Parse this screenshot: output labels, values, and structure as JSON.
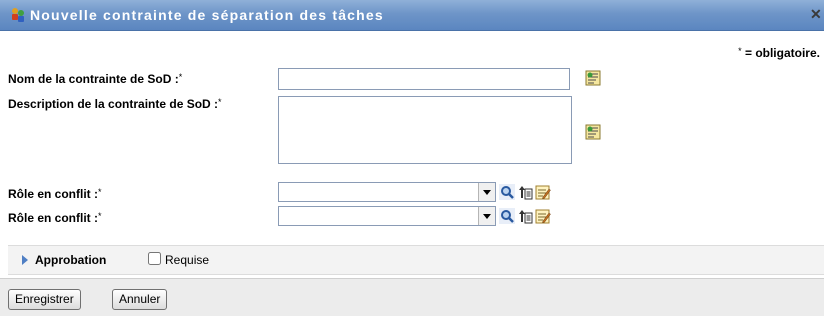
{
  "dialog": {
    "title": "Nouvelle contrainte de séparation des tâches",
    "close_symbol": "✕"
  },
  "required_note": {
    "asterisk": "*",
    "text": " = obligatoire."
  },
  "form": {
    "name_label": "Nom de la contrainte de SoD :",
    "name_value": "",
    "description_label": "Description de la contrainte de SoD :",
    "description_value": "",
    "conflict_role_1_label": "Rôle en conflit :",
    "conflict_role_1_value": "",
    "conflict_role_2_label": "Rôle en conflit :",
    "conflict_role_2_value": "",
    "required_asterisk": "*"
  },
  "approval": {
    "label": "Approbation",
    "checkbox_label": "Requise",
    "checked": false
  },
  "buttons": {
    "save": "Enregistrer",
    "cancel": "Annuler"
  },
  "icons": {
    "title": "role-conflict-icon",
    "localize": "localize-edit-icon",
    "search": "magnifier-search-icon",
    "history": "role-history-icon",
    "edit": "edit-form-icon"
  },
  "colors": {
    "title_bar": "#6e95c8",
    "approval_bar": "#f3f3f3",
    "footer": "#ececec",
    "arrow_accent": "#4f7fc4"
  }
}
